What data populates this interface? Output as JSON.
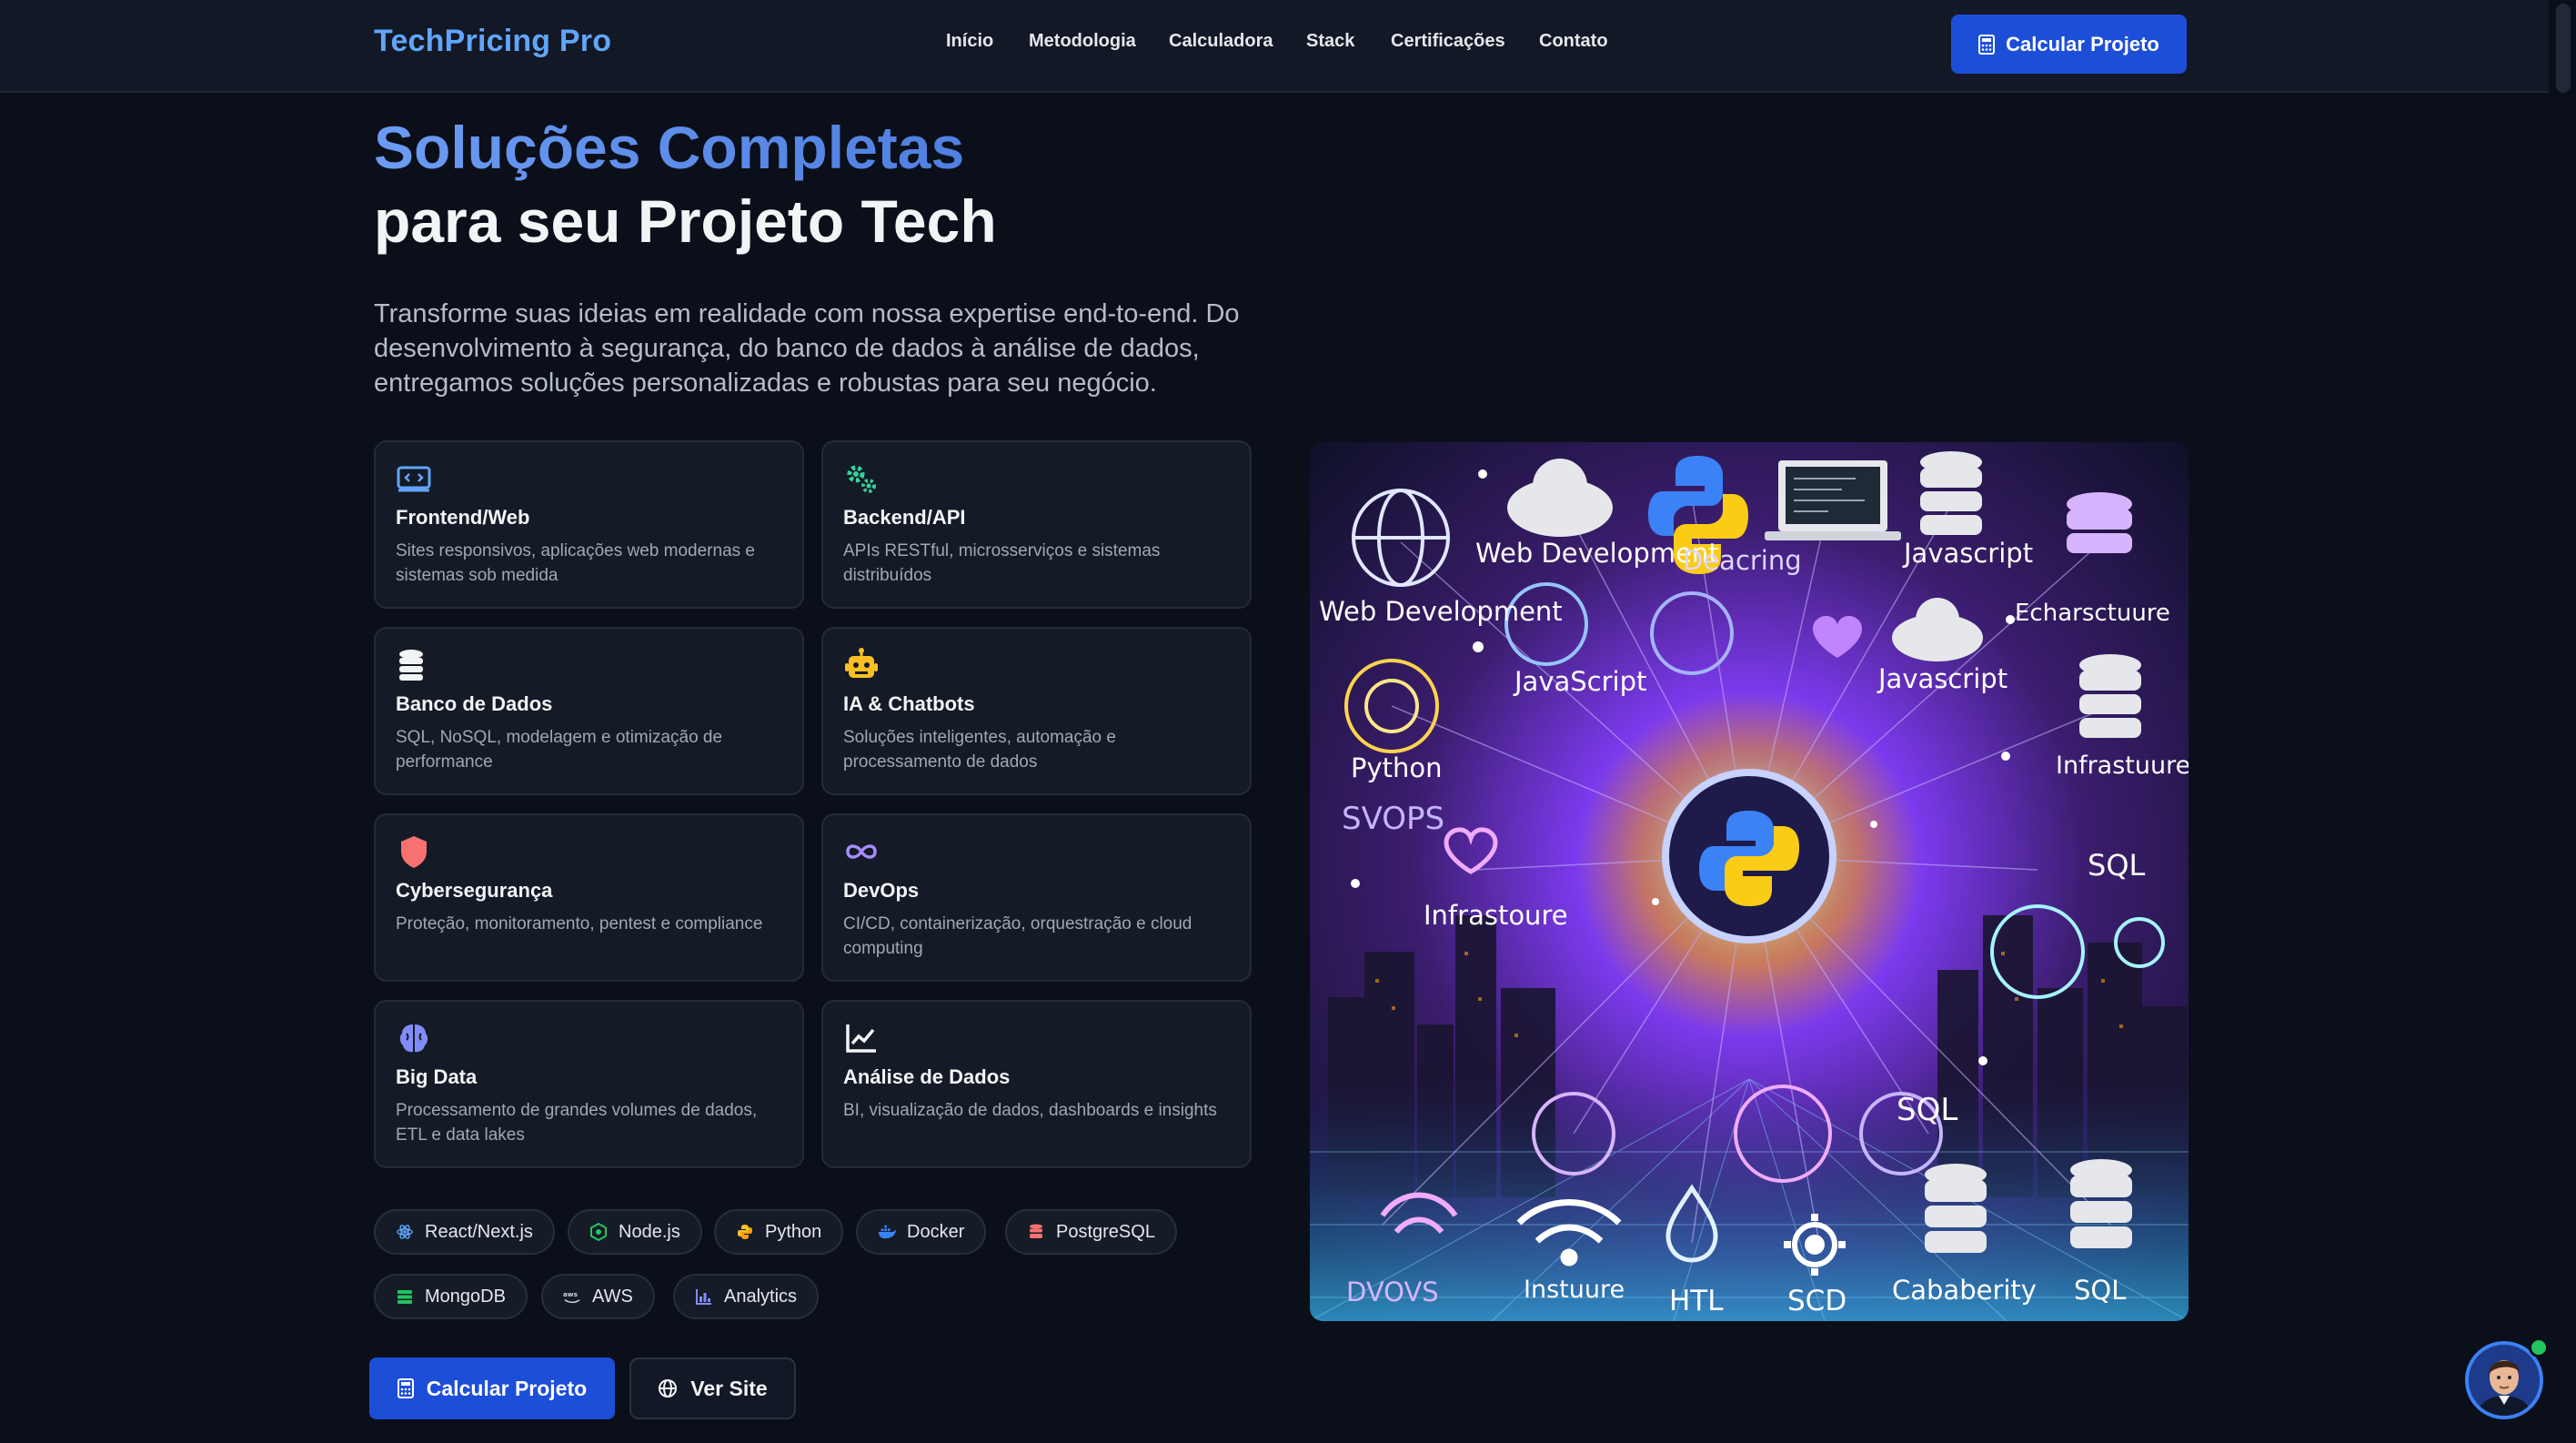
{
  "nav": {
    "brand": "TechPricing Pro",
    "links": [
      "Início",
      "Metodologia",
      "Calculadora",
      "Stack",
      "Certificações",
      "Contato"
    ],
    "cta": "Calcular Projeto"
  },
  "hero": {
    "title_line1": "Soluções Completas",
    "title_line2": "para seu Projeto Tech",
    "lead": "Transforme suas ideias em realidade com nossa expertise end-to-end. Do desenvolvimento à segurança, do banco de dados à análise de dados, entregamos soluções personalizadas e robustas para seu negócio."
  },
  "services": [
    {
      "title": "Frontend/Web",
      "desc": "Sites responsivos, aplicações web modernas e sistemas sob medida",
      "icon": "code-window-icon",
      "color": "#60a5fa"
    },
    {
      "title": "Backend/API",
      "desc": "APIs RESTful, microsserviços e sistemas distribuídos",
      "icon": "gears-icon",
      "color": "#34d399"
    },
    {
      "title": "Banco de Dados",
      "desc": "SQL, NoSQL, modelagem e otimização de performance",
      "icon": "database-icon",
      "color": "#f3f4f6"
    },
    {
      "title": "IA & Chatbots",
      "desc": "Soluções inteligentes, automação e processamento de dados",
      "icon": "robot-icon",
      "color": "#fbbf24"
    },
    {
      "title": "Cybersegurança",
      "desc": "Proteção, monitoramento, pentest e compliance",
      "icon": "shield-icon",
      "color": "#f87171"
    },
    {
      "title": "DevOps",
      "desc": "CI/CD, containerização, orquestração e cloud computing",
      "icon": "infinity-icon",
      "color": "#a78bfa"
    },
    {
      "title": "Big Data",
      "desc": "Processamento de grandes volumes de dados, ETL e data lakes",
      "icon": "brain-icon",
      "color": "#818cf8"
    },
    {
      "title": "Análise de Dados",
      "desc": "BI, visualização de dados, dashboards e insights",
      "icon": "line-chart-icon",
      "color": "#f3f4f6"
    }
  ],
  "stack": [
    {
      "label": "React/Next.js",
      "icon": "react-icon",
      "color": "#60a5fa"
    },
    {
      "label": "Node.js",
      "icon": "nodejs-icon",
      "color": "#22c55e"
    },
    {
      "label": "Python",
      "icon": "python-icon",
      "color": "#fbbf24"
    },
    {
      "label": "Docker",
      "icon": "docker-icon",
      "color": "#3b82f6"
    },
    {
      "label": "PostgreSQL",
      "icon": "postgresql-icon",
      "color": "#f87171"
    },
    {
      "label": "MongoDB",
      "icon": "mongodb-icon",
      "color": "#22c55e"
    },
    {
      "label": "AWS",
      "icon": "aws-icon",
      "color": "#d1d5db"
    },
    {
      "label": "Analytics",
      "icon": "analytics-icon",
      "color": "#818cf8"
    }
  ],
  "actions": {
    "primary": "Calcular Projeto",
    "secondary": "Ver Site"
  },
  "illustration": {
    "labels": [
      "Web Development",
      "Deacring",
      "Javascript",
      "Web Development",
      "Echarsctuure",
      "JavaScript",
      "Javascript",
      "Python",
      "Infrastuure",
      "SVOPS",
      "Infrastoure",
      "SQL",
      "SQL",
      "DVOVS",
      "Instuure",
      "HTL",
      "SCD",
      "Cababerity",
      "SQL"
    ]
  }
}
